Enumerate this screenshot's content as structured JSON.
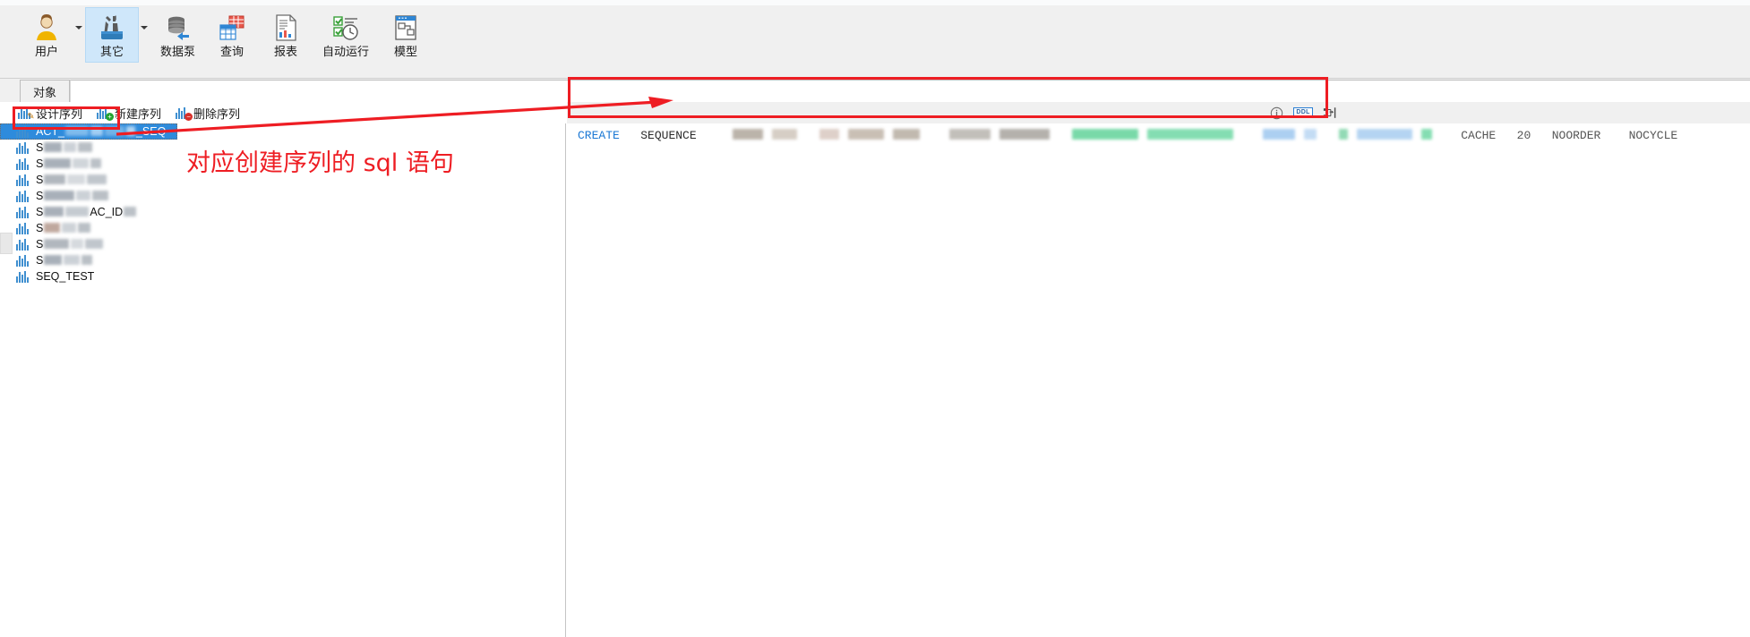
{
  "app": {
    "ribbon": {
      "items": [
        {
          "label": "用户",
          "icon": "user-icon",
          "has_caret": true,
          "active": false
        },
        {
          "label": "其它",
          "icon": "tools-icon",
          "has_caret": true,
          "active": true
        },
        {
          "label": "数据泵",
          "icon": "database-pump-icon",
          "has_caret": false,
          "active": false
        },
        {
          "label": "查询",
          "icon": "query-grid-icon",
          "has_caret": false,
          "active": false
        },
        {
          "label": "报表",
          "icon": "report-icon",
          "has_caret": false,
          "active": false
        },
        {
          "label": "自动运行",
          "icon": "automation-clock-icon",
          "has_caret": false,
          "active": false
        },
        {
          "label": "模型",
          "icon": "model-icon",
          "has_caret": false,
          "active": false
        }
      ]
    },
    "tabbar": {
      "active_tab": "对象"
    },
    "left_panel": {
      "toolbar": [
        {
          "label": "设计序列",
          "icon": "sequence-design-icon",
          "badge": "pencil"
        },
        {
          "label": "新建序列",
          "icon": "sequence-new-icon",
          "badge": "green"
        },
        {
          "label": "删除序列",
          "icon": "sequence-delete-icon",
          "badge": "red"
        }
      ],
      "tree_items": [
        {
          "text": "ACT_",
          "suffix": "_SEQ",
          "selected": true,
          "redacted": true
        },
        {
          "text": "S",
          "suffix": "",
          "selected": false,
          "redacted": true
        },
        {
          "text": "S",
          "suffix": "",
          "selected": false,
          "redacted": true
        },
        {
          "text": "S",
          "suffix": "",
          "selected": false,
          "redacted": true
        },
        {
          "text": "S",
          "suffix": "",
          "selected": false,
          "redacted": true
        },
        {
          "text": "S",
          "suffix": "AC_ID",
          "selected": false,
          "redacted": true
        },
        {
          "text": "S",
          "suffix": "",
          "selected": false,
          "redacted": true
        },
        {
          "text": "S",
          "suffix": "",
          "selected": false,
          "redacted": true
        },
        {
          "text": "S",
          "suffix": "",
          "selected": false,
          "redacted": true
        },
        {
          "text": "SEQ_TEST",
          "suffix": "",
          "selected": false,
          "redacted": false
        }
      ]
    },
    "sql_panel": {
      "icons": [
        {
          "name": "info-icon",
          "label": "i",
          "active": false
        },
        {
          "name": "ddl-toggle-icon",
          "label": "DDL",
          "active": true
        },
        {
          "name": "format-sql-icon",
          "label": "",
          "active": false
        }
      ],
      "sql_tokens": [
        {
          "text": "CREATE",
          "style": "kw-blue"
        },
        {
          "text": "SEQUENCE",
          "style": "kw-dark"
        },
        {
          "text": "CACHE",
          "style": "kw-gray"
        },
        {
          "text": "20",
          "style": "kw-gray"
        },
        {
          "text": "NOORDER",
          "style": "kw-gray"
        },
        {
          "text": "NOCYCLE",
          "style": "kw-gray"
        }
      ]
    },
    "annotations": {
      "callout_text": "对应创建序列的 sql 语句",
      "color": "#ee1d23"
    }
  }
}
